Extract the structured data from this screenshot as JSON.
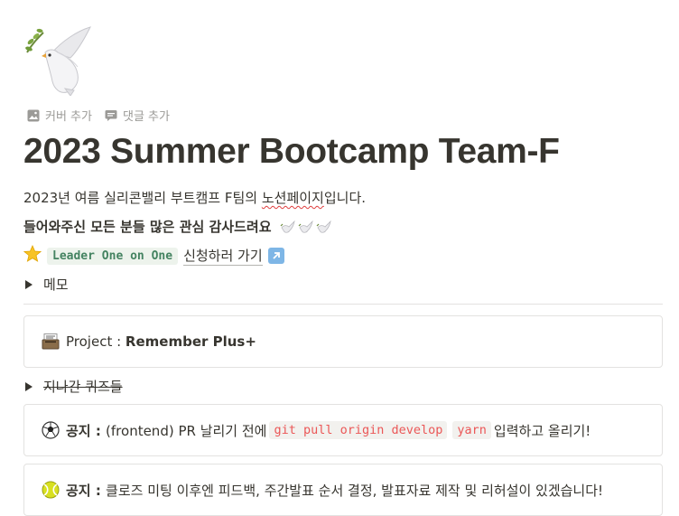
{
  "page": {
    "icon": "dove-with-olive-branch-icon",
    "actions": [
      {
        "label": "커버 추가",
        "icon": "image-icon"
      },
      {
        "label": "댓글 추가",
        "icon": "comment-icon"
      }
    ],
    "title": "2023 Summer Bootcamp Team-F",
    "description": {
      "prefix": "2023년 여름 실리콘밸리 부트캠프 F팀의 ",
      "underlined": "노션페이지",
      "suffix": "입니다."
    },
    "welcome": "들어와주신 모든 분들 많은 관심 감사드려요",
    "leader": {
      "code": "Leader One on One",
      "link": "신청하러 가기"
    },
    "toggles": {
      "memo": "메모",
      "quizzes": "지나간 퀴즈들"
    },
    "callouts": {
      "project": {
        "label": "Project : ",
        "value": "Remember Plus+"
      },
      "notice1": {
        "label": "공지 : ",
        "text_before": "(frontend) PR 날리기 전에",
        "code1": "git pull origin develop",
        "code2": "yarn",
        "text_after": "입력하고 올리기!"
      },
      "notice2": {
        "label": "공지 : ",
        "text": "클로즈 미팅 이후엔 피드백, 주간발표 순서 결정, 발표자료 제작 및 리허설이 있겠습니다!"
      }
    }
  },
  "colors": {
    "text": "#37352f",
    "muted": "#9b9a97",
    "green_code_bg": "#edf3ec",
    "green_code_text": "#448361",
    "red_code_text": "#eb5757"
  }
}
